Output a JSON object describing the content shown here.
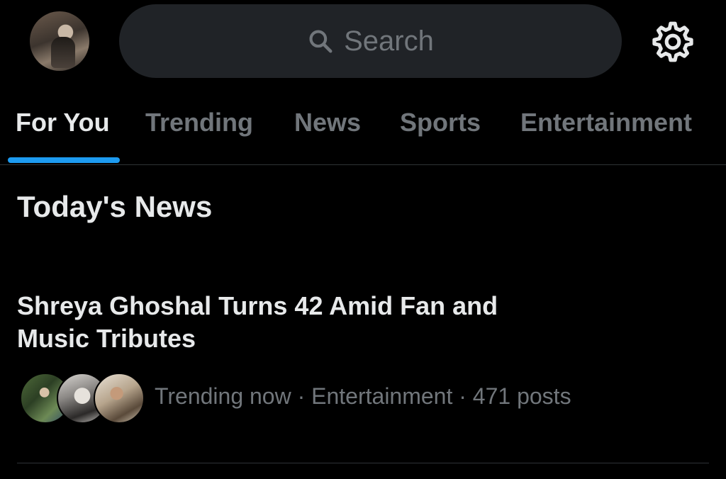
{
  "header": {
    "search": {
      "placeholder": "Search"
    }
  },
  "tabs": [
    {
      "label": "For You",
      "active": true
    },
    {
      "label": "Trending",
      "active": false
    },
    {
      "label": "News",
      "active": false
    },
    {
      "label": "Sports",
      "active": false
    },
    {
      "label": "Entertainment",
      "active": false
    }
  ],
  "section": {
    "title": "Today's News"
  },
  "news_items": [
    {
      "headline": "Shreya Ghoshal Turns 42 Amid Fan and Music Tributes",
      "meta": "Trending now · Entertainment · 471 posts"
    }
  ],
  "icons": {
    "search": "search-icon",
    "settings": "gear-icon"
  },
  "colors": {
    "background": "#000000",
    "search_bg": "#202327",
    "text_primary": "#e7e9ea",
    "text_secondary": "#71767b",
    "accent": "#1d9bf0",
    "divider": "#2f3336"
  }
}
